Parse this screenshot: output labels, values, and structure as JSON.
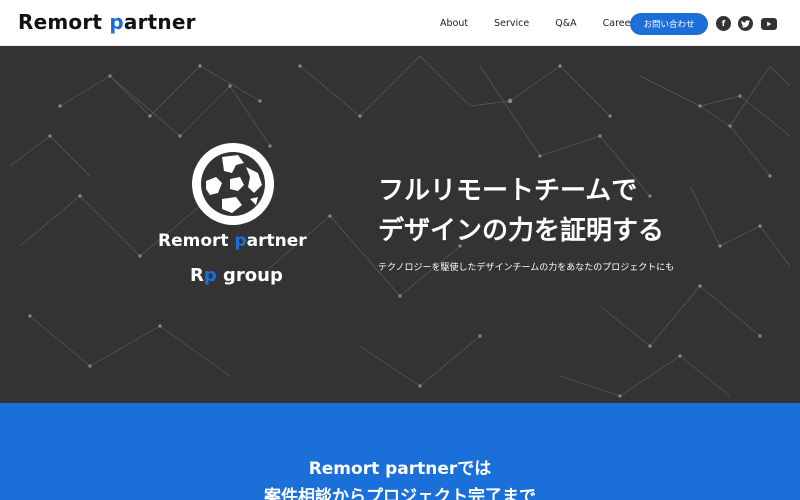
{
  "header": {
    "logo_main": "Remort ",
    "logo_accent": "p",
    "logo_rest": "artner",
    "nav": [
      "About",
      "Service",
      "Q&A",
      "Careers"
    ],
    "contact_label": "お問い合わせ",
    "social": [
      {
        "icon": "facebook-icon",
        "glyph": "f"
      },
      {
        "icon": "twitter-icon",
        "glyph": "t"
      },
      {
        "icon": "youtube-icon",
        "glyph": "▶"
      }
    ]
  },
  "hero": {
    "brand_line1_a": "Remort ",
    "brand_line1_accent": "p",
    "brand_line1_b": "artner",
    "brand_line2_a": "R",
    "brand_line2_accent": "p",
    "brand_line2_b": " group",
    "headline_1": "フルリモートチームで",
    "headline_2": "デザインの力を証明する",
    "subline": "テクノロジーを駆使したデザインチームの力をあなたのプロジェクトにも"
  },
  "section": {
    "line1": "Remort partnerでは",
    "line2": "案件相談からプロジェクト完了まで"
  },
  "colors": {
    "accent": "#1c6fd9",
    "hero_bg": "#333333",
    "section_bg": "#1a6fd9"
  }
}
